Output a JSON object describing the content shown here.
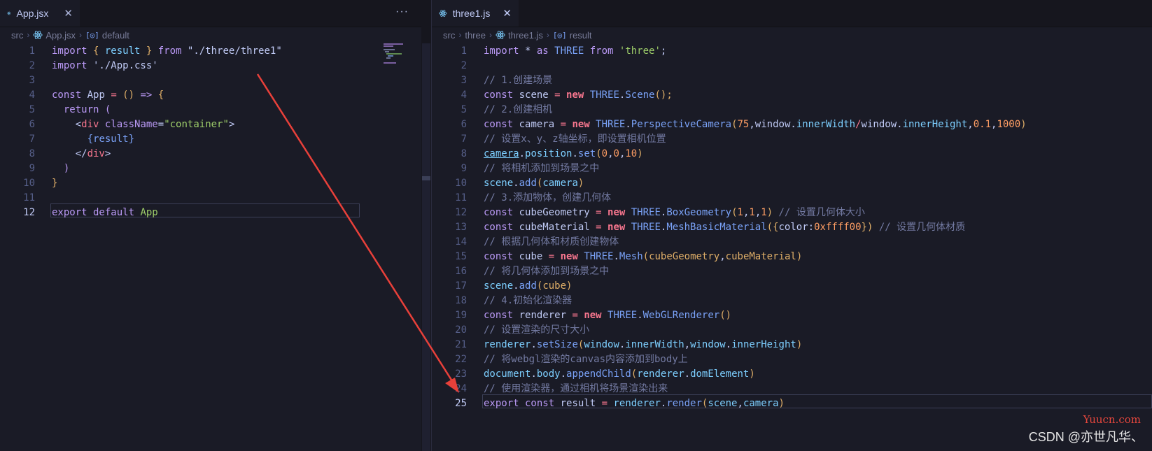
{
  "left": {
    "tab": {
      "label": "App.jsx",
      "close": "✕"
    },
    "more": "···",
    "breadcrumb": [
      "src",
      "App.jsx",
      "default"
    ],
    "lines": [
      {
        "n": "1"
      },
      {
        "n": "2"
      },
      {
        "n": "3"
      },
      {
        "n": "4"
      },
      {
        "n": "5"
      },
      {
        "n": "6"
      },
      {
        "n": "7"
      },
      {
        "n": "8"
      },
      {
        "n": "9"
      },
      {
        "n": "10"
      },
      {
        "n": "11"
      },
      {
        "n": "12"
      }
    ],
    "code": {
      "l1a": "import",
      "l1b": " { ",
      "l1c": "result",
      "l1d": " } ",
      "l1e": "from",
      "l1f": " \"./three/three1\"",
      "l2a": "import",
      "l2b": " './App.css'",
      "l4a": "const",
      "l4b": " App ",
      "l4c": "=",
      "l4d": " () ",
      "l4e": "=>",
      "l4f": " {",
      "l5a": "  return",
      "l5b": " (",
      "l6a": "    <",
      "l6b": "div",
      "l6c": " className",
      "l6d": "=",
      "l6e": "\"container\"",
      "l6f": ">",
      "l7a": "      {",
      "l7b": "result",
      "l7c": "}",
      "l8a": "    </",
      "l8b": "div",
      "l8c": ">",
      "l9a": "  )",
      "l10a": "}",
      "l12a": "export",
      "l12b": " default",
      "l12c": " App"
    }
  },
  "right": {
    "tab": {
      "label": "three1.js",
      "close": "✕"
    },
    "breadcrumb": [
      "src",
      "three",
      "three1.js",
      "result"
    ],
    "lines": [
      {
        "n": "1"
      },
      {
        "n": "2"
      },
      {
        "n": "3"
      },
      {
        "n": "4"
      },
      {
        "n": "5"
      },
      {
        "n": "6"
      },
      {
        "n": "7"
      },
      {
        "n": "8"
      },
      {
        "n": "9"
      },
      {
        "n": "10"
      },
      {
        "n": "11"
      },
      {
        "n": "12"
      },
      {
        "n": "13"
      },
      {
        "n": "14"
      },
      {
        "n": "15"
      },
      {
        "n": "16"
      },
      {
        "n": "17"
      },
      {
        "n": "18"
      },
      {
        "n": "19"
      },
      {
        "n": "20"
      },
      {
        "n": "21"
      },
      {
        "n": "22"
      },
      {
        "n": "23"
      },
      {
        "n": "24"
      },
      {
        "n": "25"
      }
    ],
    "code": {
      "r1a": "import",
      "r1b": " * ",
      "r1c": "as",
      "r1d": " THREE ",
      "r1e": "from",
      "r1f": " 'three'",
      "r1g": ";",
      "r3": "// 1.创建场景",
      "r4a": "const",
      "r4b": " scene ",
      "r4c": "=",
      "r4d": " new",
      "r4e": " THREE",
      "r4f": ".",
      "r4g": "Scene",
      "r4h": "();",
      "r5": "// 2.创建相机",
      "r6a": "const",
      "r6b": " camera ",
      "r6c": "=",
      "r6d": " new",
      "r6e": " THREE",
      "r6f": ".",
      "r6g": "PerspectiveCamera",
      "r6h": "(",
      "r6i": "75",
      "r6j": ",",
      "r6k": "window",
      "r6l": ".",
      "r6m": "innerWidth",
      "r6n": "/",
      "r6o": "window",
      "r6p": ".",
      "r6q": "innerHeight",
      "r6r": ",",
      "r6s": "0.1",
      "r6t": ",",
      "r6u": "1000",
      "r6v": ")",
      "r7": "// 设置x、y、z轴坐标，即设置相机位置",
      "r8a": "camera",
      "r8b": ".",
      "r8c": "position",
      "r8d": ".",
      "r8e": "set",
      "r8f": "(",
      "r8g": "0",
      "r8h": ",",
      "r8i": "0",
      "r8j": ",",
      "r8k": "10",
      "r8l": ")",
      "r9": "// 将相机添加到场景之中",
      "r10a": "scene",
      "r10b": ".",
      "r10c": "add",
      "r10d": "(",
      "r10e": "camera",
      "r10f": ")",
      "r11": "// 3.添加物体，创建几何体",
      "r12a": "const",
      "r12b": " cubeGeometry ",
      "r12c": "=",
      "r12d": " new",
      "r12e": " THREE",
      "r12f": ".",
      "r12g": "BoxGeometry",
      "r12h": "(",
      "r12i": "1",
      "r12j": ",",
      "r12k": "1",
      "r12l": ",",
      "r12m": "1",
      "r12n": ")",
      "r12o": " // 设置几何体大小",
      "r13a": "const",
      "r13b": " cubeMaterial ",
      "r13c": "=",
      "r13d": " new",
      "r13e": " THREE",
      "r13f": ".",
      "r13g": "MeshBasicMaterial",
      "r13h": "({",
      "r13i": "color",
      "r13j": ":",
      "r13k": "0xffff00",
      "r13l": "})",
      "r13m": " // 设置几何体材质",
      "r14": "// 根据几何体和材质创建物体",
      "r15a": "const",
      "r15b": " cube ",
      "r15c": "=",
      "r15d": " new",
      "r15e": " THREE",
      "r15f": ".",
      "r15g": "Mesh",
      "r15h": "(",
      "r15i": "cubeGeometry",
      "r15j": ",",
      "r15k": "cubeMaterial",
      "r15l": ")",
      "r16": "// 将几何体添加到场景之中",
      "r17a": "scene",
      "r17b": ".",
      "r17c": "add",
      "r17d": "(",
      "r17e": "cube",
      "r17f": ")",
      "r18": "// 4.初始化渲染器",
      "r19a": "const",
      "r19b": " renderer ",
      "r19c": "=",
      "r19d": " new",
      "r19e": " THREE",
      "r19f": ".",
      "r19g": "WebGLRenderer",
      "r19h": "()",
      "r20": "// 设置渲染的尺寸大小",
      "r21a": "renderer",
      "r21b": ".",
      "r21c": "setSize",
      "r21d": "(",
      "r21e": "window",
      "r21f": ".",
      "r21g": "innerWidth",
      "r21h": ",",
      "r21i": "window",
      "r21j": ".",
      "r21k": "innerHeight",
      "r21l": ")",
      "r22": "// 将webgl渲染的canvas内容添加到body上",
      "r23a": "document",
      "r23b": ".",
      "r23c": "body",
      "r23d": ".",
      "r23e": "appendChild",
      "r23f": "(",
      "r23g": "renderer",
      "r23h": ".",
      "r23i": "domElement",
      "r23j": ")",
      "r24": "// 使用渲染器，通过相机将场景渲染出来",
      "r25a": "export",
      "r25b": " const",
      "r25c": " result ",
      "r25d": "=",
      "r25e": " renderer",
      "r25f": ".",
      "r25g": "render",
      "r25h": "(",
      "r25i": "scene",
      "r25j": ",",
      "r25k": "camera",
      "r25l": ")"
    }
  },
  "watermark": {
    "csdn": "CSDN @亦世凡华、",
    "yuucn": "Yuucn.com"
  },
  "colors": {
    "bg": "#1a1b26",
    "tabbar": "#16161e",
    "keyword": "#bb9af7",
    "string": "#9ece6a",
    "arrow": "#e8403a"
  }
}
